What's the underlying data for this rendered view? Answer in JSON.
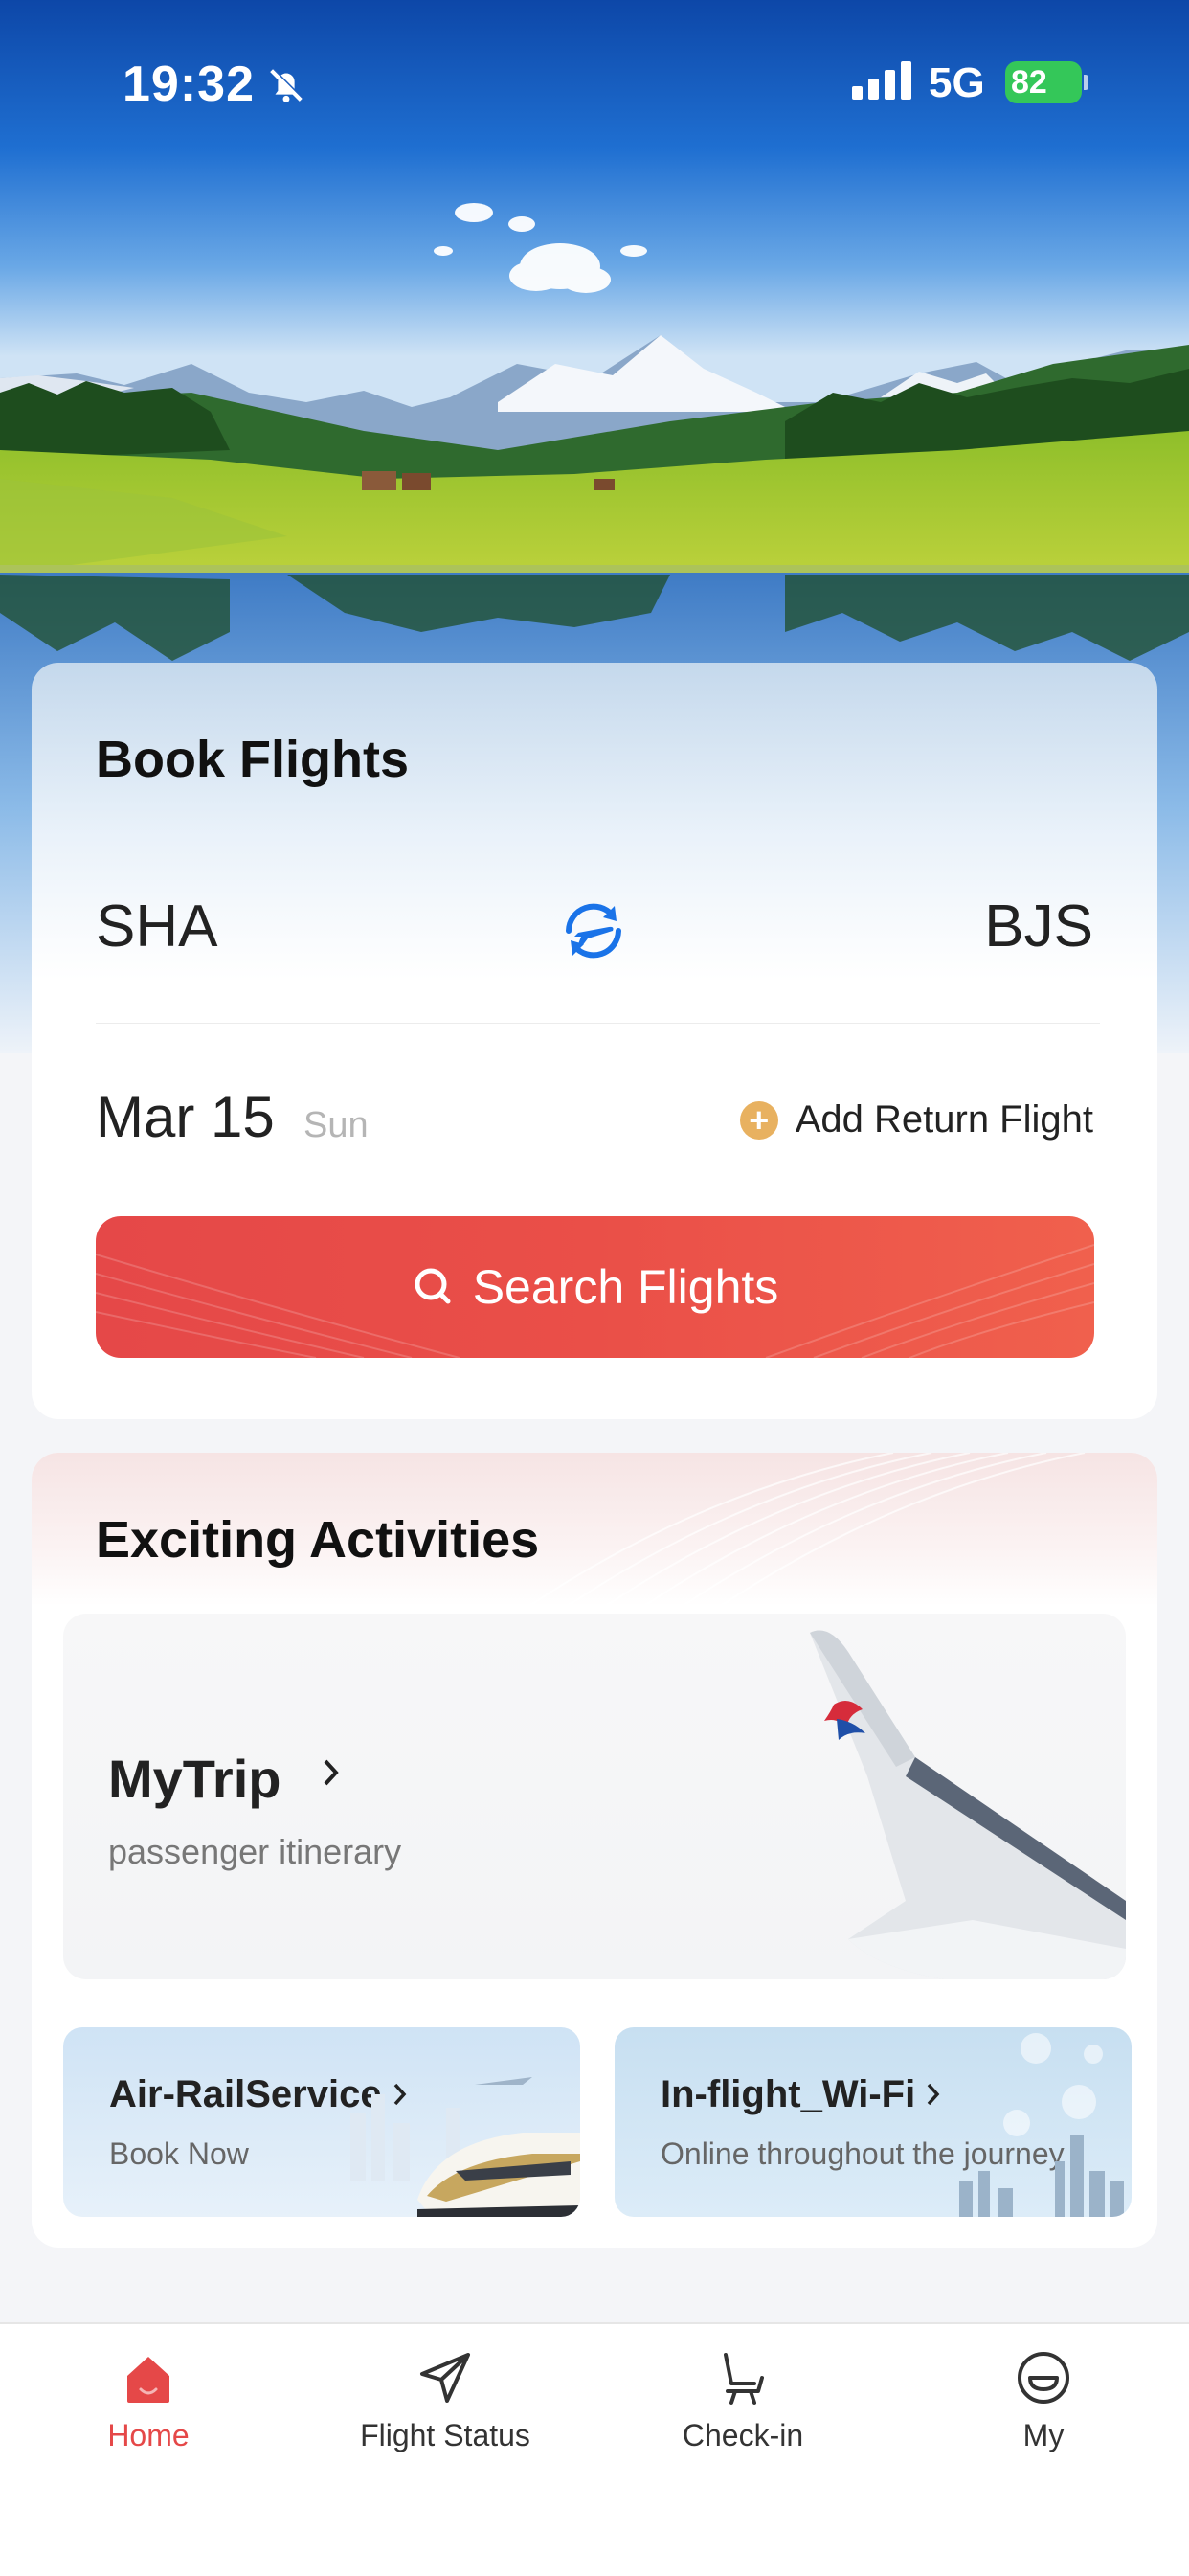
{
  "status_bar": {
    "time": "19:32",
    "network": "5G",
    "battery": "82",
    "icons": [
      "bell-slash-icon",
      "signal-icon",
      "battery-charging-icon"
    ]
  },
  "book": {
    "title": "Book Flights",
    "from": "SHA",
    "to": "BJS",
    "swap_icon": "plane-swap-icon",
    "date": "Mar 15",
    "weekday": "Sun",
    "add_return_label": "Add Return Flight",
    "search_label": "Search Flights"
  },
  "activities": {
    "title": "Exciting Activities",
    "mytrip": {
      "label": "MyTrip",
      "sub": "passenger itinerary"
    },
    "rail": {
      "label": "Air-RailService",
      "sub": "Book Now"
    },
    "wifi": {
      "label": "In-flight_Wi-Fi",
      "sub": "Online throughout the journey"
    }
  },
  "tabbar": {
    "tabs": [
      {
        "label": "Home",
        "icon": "home-icon",
        "active": true
      },
      {
        "label": "Flight Status",
        "icon": "paper-plane-icon",
        "active": false
      },
      {
        "label": "Check-in",
        "icon": "seat-icon",
        "active": false
      },
      {
        "label": "My",
        "icon": "profile-icon",
        "active": false
      }
    ]
  },
  "colors": {
    "accent": "#e54848",
    "swap_blue": "#1a73e8",
    "plus_orange": "#e8b160",
    "battery_green": "#34c759"
  }
}
